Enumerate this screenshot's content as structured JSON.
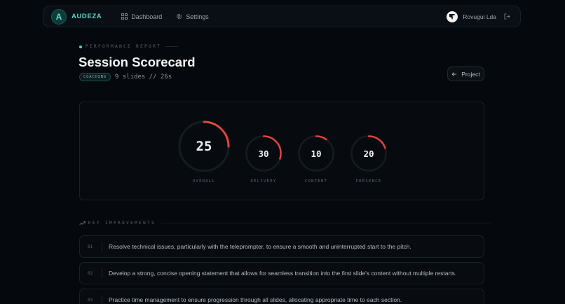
{
  "nav": {
    "brand": "AUDEZA",
    "brand_initial": "A",
    "items": [
      {
        "label": "Dashboard",
        "icon": "grid-icon"
      },
      {
        "label": "Settings",
        "icon": "gear-icon"
      }
    ],
    "user_name": "Rovugui Lda"
  },
  "header": {
    "eyebrow": "PERFORMANCE REPORT",
    "title": "Session Scorecard",
    "tag": "COACHING",
    "meta": "9 slides // 26s",
    "project_button": "Project"
  },
  "scores": [
    {
      "label": "OVERALL",
      "value": "25",
      "fraction": 0.25
    },
    {
      "label": "DELIVERY",
      "value": "30",
      "fraction": 0.3
    },
    {
      "label": "CONTENT",
      "value": "10",
      "fraction": 0.1
    },
    {
      "label": "PRESENCE",
      "value": "20",
      "fraction": 0.2
    }
  ],
  "improvements": {
    "heading": "KEY IMPROVEMENTS",
    "items": [
      {
        "num": "01",
        "text": "Resolve technical issues, particularly with the teleprompter, to ensure a smooth and uninterrupted start to the pitch."
      },
      {
        "num": "02",
        "text": "Develop a strong, concise opening statement that allows for seamless transition into the first slide's content without multiple restarts."
      },
      {
        "num": "03",
        "text": "Practice time management to ensure progression through all slides, allocating appropriate time to each section."
      }
    ]
  },
  "colors": {
    "accent": "#56d6c6",
    "gauge_arc": "#e0473c",
    "background": "#05080c"
  }
}
